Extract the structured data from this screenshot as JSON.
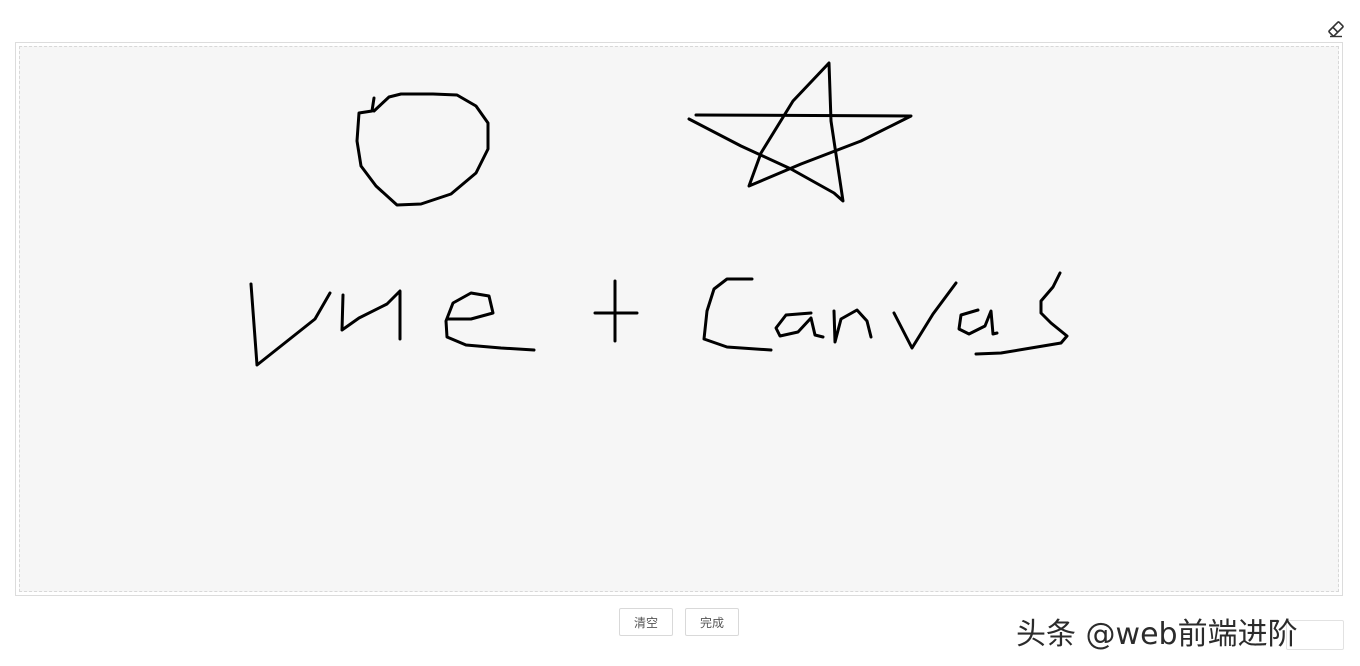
{
  "toolbar": {
    "eraser_icon": "eraser-icon"
  },
  "actions": {
    "clear_label": "清空",
    "done_label": "完成"
  },
  "watermark": {
    "text": "头条 @web前端进阶"
  },
  "colors": {
    "canvas_background": "#f6f6f6",
    "stroke": "#000000"
  }
}
